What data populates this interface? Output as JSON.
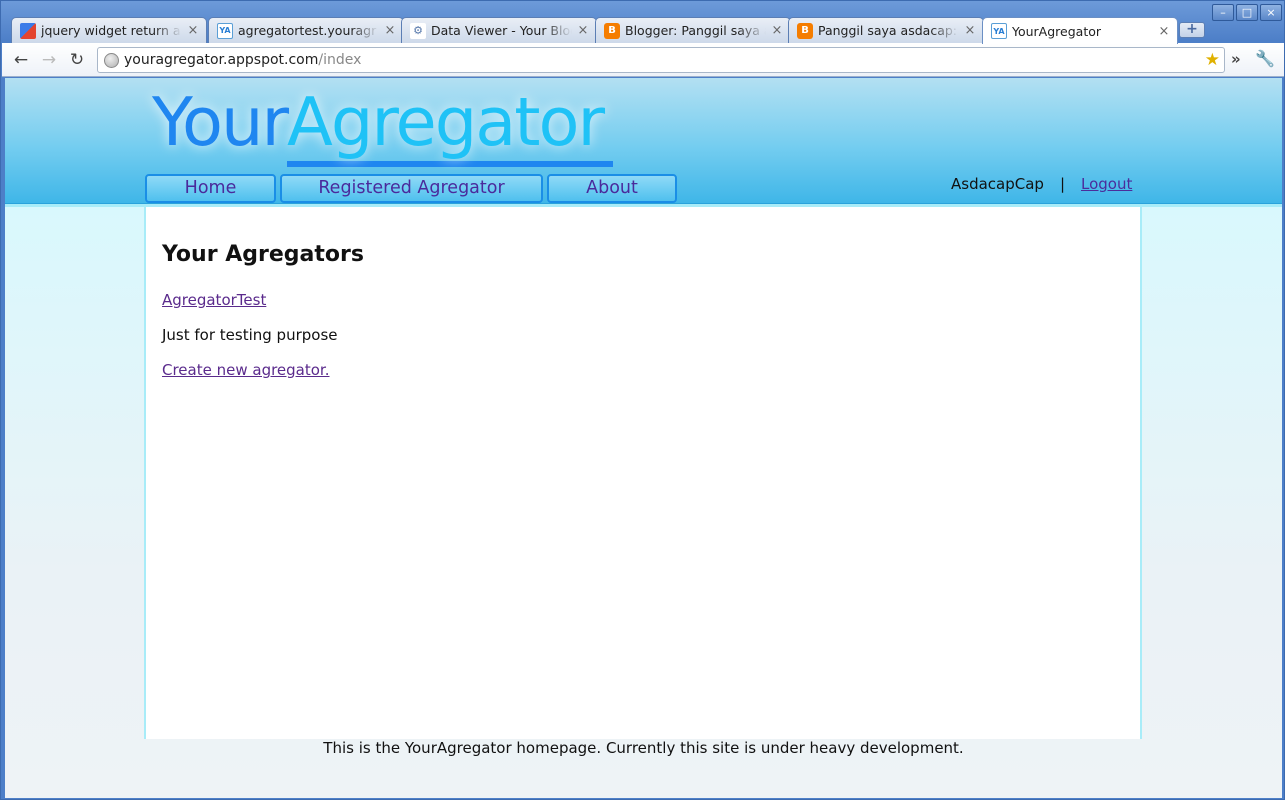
{
  "browser": {
    "tabs": [
      {
        "title": "jquery widget return a",
        "favicon": "google-icon"
      },
      {
        "title": "agregatortest.youragr",
        "favicon": "youragregator-icon"
      },
      {
        "title": "Data Viewer - Your Blog",
        "favicon": "data-viewer-icon"
      },
      {
        "title": "Blogger: Panggil saya a",
        "favicon": "blogger-icon"
      },
      {
        "title": "Panggil saya asdacap:",
        "favicon": "blogger-icon"
      },
      {
        "title": "YourAgregator",
        "favicon": "youragregator-icon"
      }
    ],
    "active_tab_index": 5,
    "url_host": "youragregator.appspot.com",
    "url_path": "/index"
  },
  "site": {
    "logo_part1": "Your",
    "logo_part2": "Agregator",
    "nav": [
      "Home",
      "Registered Agregator",
      "About"
    ],
    "username": "AsdacapCap",
    "separator": "|",
    "logout": "Logout"
  },
  "main": {
    "heading": "Your Agregators",
    "agregators": [
      {
        "name": "AgregatorTest",
        "description": "Just for testing purpose"
      }
    ],
    "create_link": "Create new agregator."
  },
  "footer": "This is the YourAgregator homepage. Currently this site is under heavy development.",
  "colors": {
    "logo_dark_blue": "#1f86f0",
    "logo_cyan": "#1fc2f6",
    "nav_text": "#4a2a9c",
    "link": "#5a2a8c"
  }
}
